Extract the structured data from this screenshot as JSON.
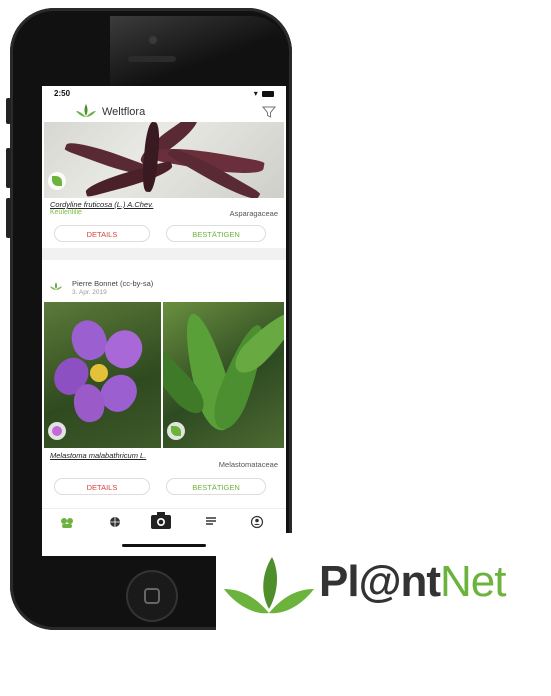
{
  "status": {
    "time": "2:50",
    "signal": "▾ ▬"
  },
  "app": {
    "title": "Weltflora"
  },
  "cards": [
    {
      "scientific_name": "Cordyline fruticosa (L.) A.Chev.",
      "common_name": "Keulenlilie",
      "family": "Asparagaceae",
      "details_label": "DETAILS",
      "confirm_label": "BESTÄTIGEN"
    },
    {
      "author": "Pierre Bonnet (cc-by-sa)",
      "date": "3. Apr. 2019",
      "scientific_name": "Melastoma malabathricum L.",
      "family": "Melastomataceae",
      "details_label": "DETAILS",
      "confirm_label": "BESTÄTIGEN"
    }
  ],
  "tabbar": {
    "items": [
      "plants-icon",
      "globe-icon",
      "camera-icon",
      "list-icon",
      "profile-icon"
    ]
  },
  "brand": {
    "logo_text_pre": "Pl@nt",
    "logo_text_post": "Net"
  },
  "colors": {
    "accent_green": "#6cb33e",
    "details_red": "#d4453d"
  }
}
